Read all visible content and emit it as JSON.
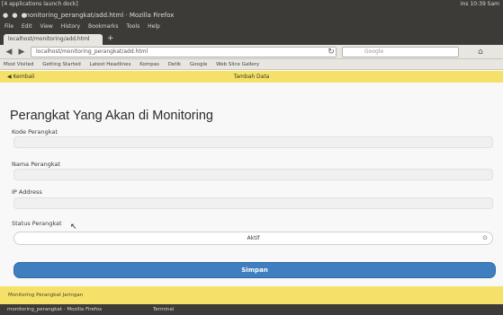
{
  "top_panel": {
    "left_text": "[4 applications launch dock]",
    "right_text": "Ins 10:39 Sam"
  },
  "window": {
    "title": "monitoring_perangkat/add.html · Mozilla Firefox",
    "controls": "● ● ●"
  },
  "menu": {
    "items": [
      "File",
      "Edit",
      "View",
      "History",
      "Bookmarks",
      "Tools",
      "Help"
    ]
  },
  "tab": {
    "label": "localhost/monitoring/add.html",
    "new_tab": "+"
  },
  "nav": {
    "back": "◀",
    "forward": "▶",
    "url": "localhost/monitoring_perangkat/add.html",
    "reload": "↻",
    "search_placeholder": "Google",
    "home": "⌂"
  },
  "bookmarks": {
    "items": [
      "Most Visited",
      "Getting Started",
      "Latest Headlines",
      "Kompas",
      "Detik",
      "Google",
      "Web Slice Gallery"
    ]
  },
  "app_bar": {
    "back_label": "◀ Kembali",
    "title": "Tambah Data"
  },
  "form": {
    "title": "Perangkat Yang Akan di Monitoring",
    "fields": [
      {
        "label": "Kode Perangkat"
      },
      {
        "label": "Nama Perangkat"
      },
      {
        "label": "IP Address"
      },
      {
        "label": "Status Perangkat"
      }
    ],
    "select_value": "Aktif",
    "select_chevron": "⊙",
    "submit_label": "Simpan"
  },
  "footer": {
    "text": "Monitoring Perangkat Jaringan"
  },
  "taskbar": {
    "items": [
      "monitoring_perangkat - Mozilla Firefox",
      "Terminal"
    ]
  }
}
